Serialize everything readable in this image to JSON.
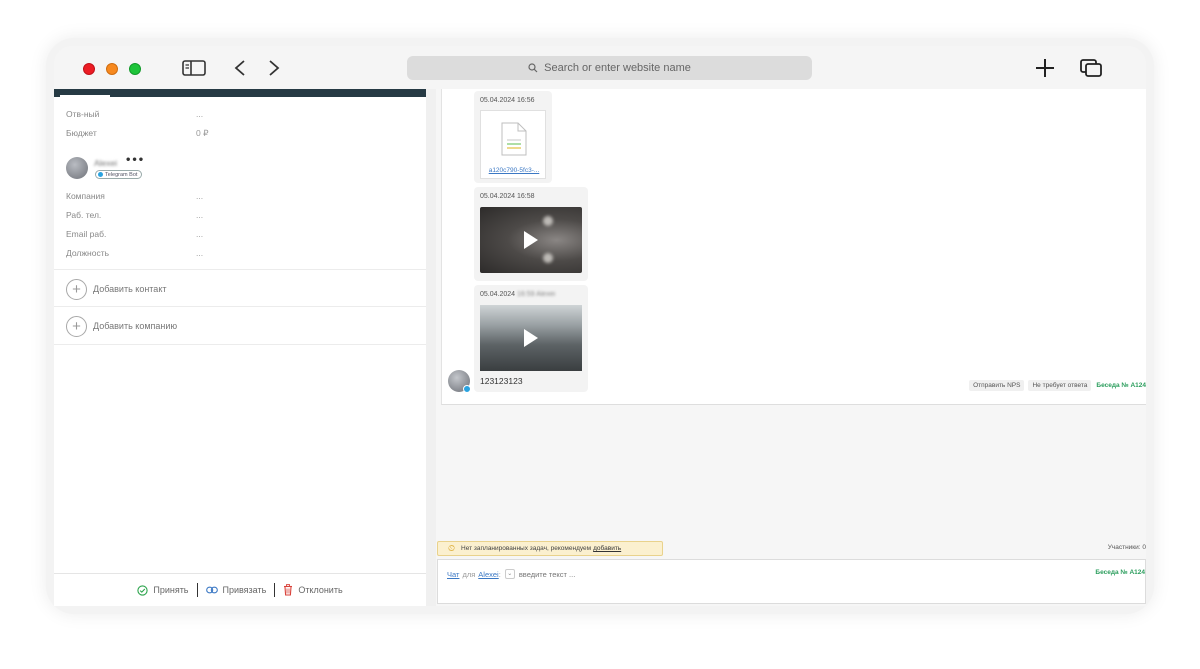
{
  "browser": {
    "search_placeholder": "Search or enter website name"
  },
  "left_panel": {
    "fields_top": [
      {
        "label": "Отв-ный",
        "value": "..."
      },
      {
        "label": "Бюджет",
        "value": "0 ₽"
      }
    ],
    "contact": {
      "name": "Alexei",
      "more": "•••",
      "badge": "Telegram Bot"
    },
    "fields_contact": [
      {
        "label": "Компания",
        "value": "..."
      },
      {
        "label": "Раб. тел.",
        "value": "..."
      },
      {
        "label": "Email раб.",
        "value": "..."
      },
      {
        "label": "Должность",
        "value": "..."
      }
    ],
    "add_contact": "Добавить контакт",
    "add_company": "Добавить компанию",
    "footer": {
      "accept": "Принять",
      "link": "Привязать",
      "reject": "Отклонить"
    }
  },
  "chat": {
    "messages": [
      {
        "timestamp": "05.04.2024 16:56",
        "file_name": "a120c790-5fc3-..."
      },
      {
        "timestamp": "05.04.2024 16:58"
      },
      {
        "timestamp": "05.04.2024",
        "timestamp_blurred": "16:59 Alexei",
        "text": "123123123"
      }
    ],
    "actions": {
      "send_nps": "Отправить NPS",
      "no_reply": "Не требует ответа",
      "conversation": "Беседа № A124"
    },
    "tasks": {
      "text": "Нет запланированных задач, рекомендуем",
      "add_link": "добавить"
    },
    "participants": "Участники: 0",
    "input": {
      "chat_link": "Чат",
      "for_text": "для",
      "recipient": "Alexei",
      "colon": ":",
      "placeholder": "введите текст ...",
      "conversation": "Беседа № A124"
    }
  },
  "colors": {
    "accent_green": "#2a9d5c",
    "link_blue": "#3b78c4",
    "topbar_dark": "#263a44",
    "task_bg": "#fbf0cf"
  }
}
